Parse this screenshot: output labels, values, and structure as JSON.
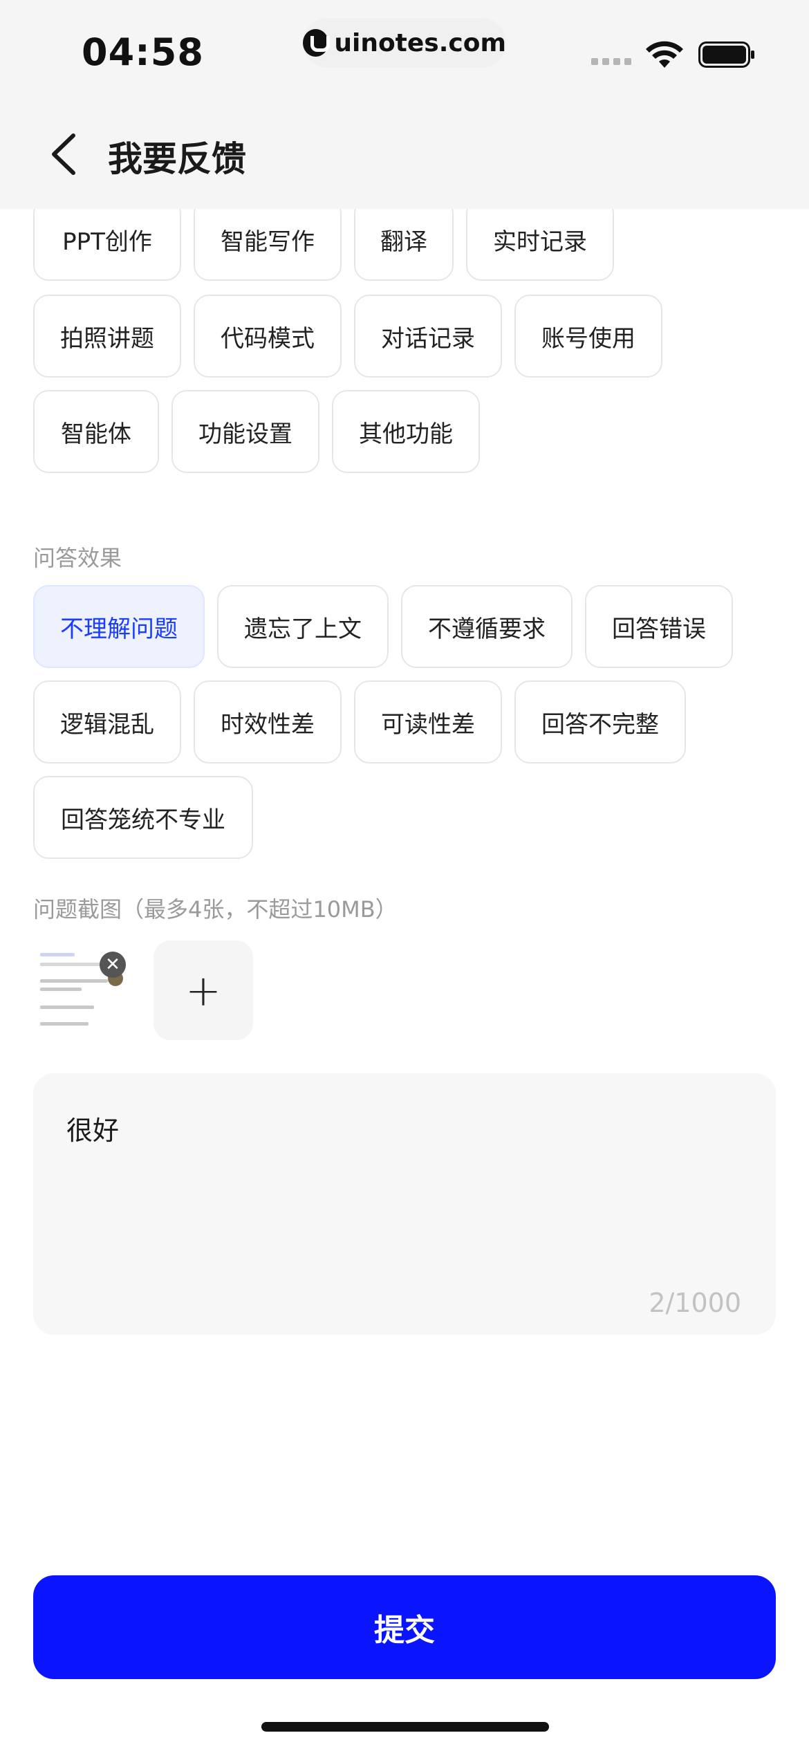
{
  "status_bar": {
    "time": "04:58",
    "url": "uinotes.com"
  },
  "header": {
    "title": "我要反馈"
  },
  "feature_chips": {
    "rows": [
      [
        "PPT创作",
        "智能写作",
        "翻译",
        "实时记录"
      ],
      [
        "拍照讲题",
        "代码模式",
        "对话记录",
        "账号使用"
      ],
      [
        "智能体",
        "功能设置",
        "其他功能"
      ]
    ]
  },
  "answer_quality": {
    "label": "问答效果",
    "rows": [
      [
        "不理解问题",
        "遗忘了上文",
        "不遵循要求",
        "回答错误"
      ],
      [
        "逻辑混乱",
        "时效性差",
        "可读性差",
        "回答不完整"
      ],
      [
        "回答笼统不专业"
      ]
    ],
    "selected": "不理解问题"
  },
  "screenshots": {
    "label": "问题截图（最多4张，不超过10MB）",
    "add_symbol": "+",
    "remove_symbol": "✕"
  },
  "feedback": {
    "value": "很好",
    "counter": "2/1000"
  },
  "submit": {
    "label": "提交"
  },
  "colors": {
    "accent": "#0a14ff",
    "selected_chip_bg": "#eef2ff",
    "selected_chip_text": "#1a3cff"
  }
}
